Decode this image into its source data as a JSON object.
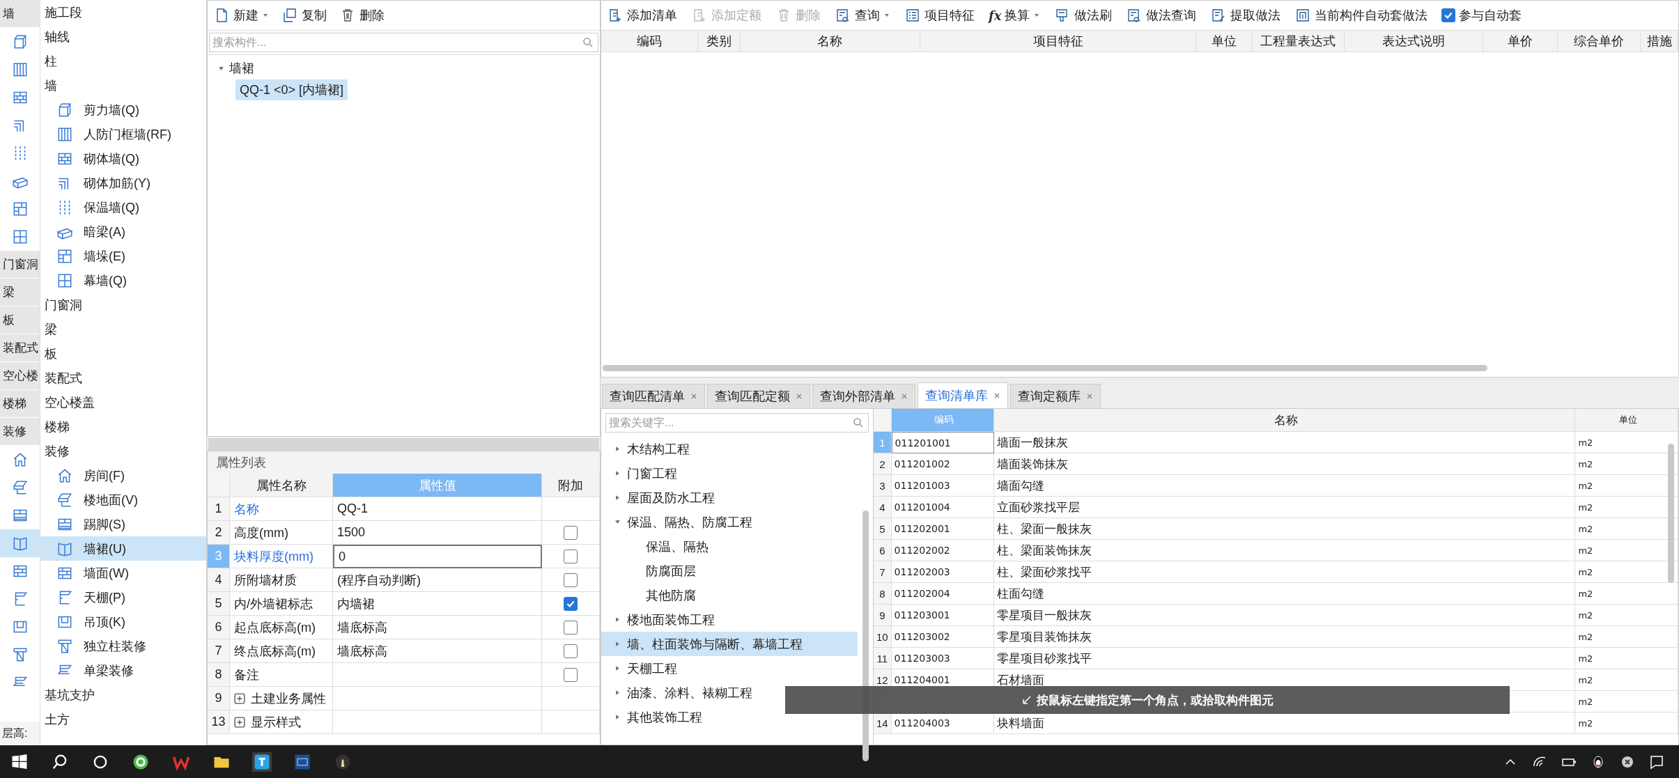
{
  "icon_strip": [
    {
      "kind": "header",
      "label": "墙"
    },
    {
      "kind": "icon",
      "selected": false
    },
    {
      "kind": "icon",
      "selected": false
    },
    {
      "kind": "icon",
      "selected": false
    },
    {
      "kind": "icon",
      "selected": false
    },
    {
      "kind": "icon",
      "selected": false
    },
    {
      "kind": "icon",
      "selected": false
    },
    {
      "kind": "icon",
      "selected": false
    },
    {
      "kind": "icon",
      "selected": false
    },
    {
      "kind": "header",
      "label": "门窗洞"
    },
    {
      "kind": "header",
      "label": "梁"
    },
    {
      "kind": "header",
      "label": "板"
    },
    {
      "kind": "header",
      "label": "装配式"
    },
    {
      "kind": "header",
      "label": "空心楼"
    },
    {
      "kind": "header",
      "label": "楼梯"
    },
    {
      "kind": "header",
      "label": "装修"
    },
    {
      "kind": "icon",
      "selected": false
    },
    {
      "kind": "icon",
      "selected": false
    },
    {
      "kind": "icon",
      "selected": false
    },
    {
      "kind": "icon",
      "selected": true
    },
    {
      "kind": "icon",
      "selected": false
    },
    {
      "kind": "icon",
      "selected": false
    },
    {
      "kind": "icon",
      "selected": false
    },
    {
      "kind": "icon",
      "selected": false
    },
    {
      "kind": "icon",
      "selected": false
    }
  ],
  "floor_height_label": "层高:",
  "component_types": [
    {
      "label": "施工段",
      "selected": false
    },
    {
      "label": "轴线",
      "selected": false
    },
    {
      "label": "柱",
      "selected": false
    },
    {
      "label": "墙",
      "selected": false,
      "children": [
        {
          "label": "剪力墙(Q)",
          "selected": false
        },
        {
          "label": "人防门框墙(RF)",
          "selected": false
        },
        {
          "label": "砌体墙(Q)",
          "selected": false
        },
        {
          "label": "砌体加筋(Y)",
          "selected": false
        },
        {
          "label": "保温墙(Q)",
          "selected": false
        },
        {
          "label": "暗梁(A)",
          "selected": false
        },
        {
          "label": "墙垛(E)",
          "selected": false
        },
        {
          "label": "幕墙(Q)",
          "selected": false
        }
      ]
    },
    {
      "label": "门窗洞",
      "selected": false
    },
    {
      "label": "梁",
      "selected": false
    },
    {
      "label": "板",
      "selected": false
    },
    {
      "label": "装配式",
      "selected": false
    },
    {
      "label": "空心楼盖",
      "selected": false
    },
    {
      "label": "楼梯",
      "selected": false
    },
    {
      "label": "装修",
      "selected": false,
      "children": [
        {
          "label": "房间(F)",
          "selected": false
        },
        {
          "label": "楼地面(V)",
          "selected": false
        },
        {
          "label": "踢脚(S)",
          "selected": false
        },
        {
          "label": "墙裙(U)",
          "selected": true
        },
        {
          "label": "墙面(W)",
          "selected": false
        },
        {
          "label": "天棚(P)",
          "selected": false
        },
        {
          "label": "吊顶(K)",
          "selected": false
        },
        {
          "label": "独立柱装修",
          "selected": false
        },
        {
          "label": "单梁装修",
          "selected": false
        }
      ]
    },
    {
      "label": "基坑支护",
      "selected": false
    },
    {
      "label": "土方",
      "selected": false
    }
  ],
  "component_toolbar": [
    {
      "label": "新建",
      "dropdown": true
    },
    {
      "label": "复制",
      "dropdown": false
    },
    {
      "label": "删除",
      "dropdown": false
    }
  ],
  "component_search": {
    "placeholder": "搜索构件..."
  },
  "component_list": [
    {
      "label": "墙裙",
      "expanded": true,
      "children": [
        {
          "label": "QQ-1 <0> [内墙裙]",
          "selected": true
        }
      ]
    }
  ],
  "properties": {
    "title": "属性列表",
    "columns": [
      "属性名称",
      "属性值",
      "附加"
    ],
    "rows": [
      {
        "no": "1",
        "name": "名称",
        "value": "QQ-1",
        "kind": "fixed",
        "emphasized": true,
        "selected": false
      },
      {
        "no": "2",
        "name": "高度(mm)",
        "value": "1500",
        "kind": "check",
        "attached": false,
        "emphasized": false,
        "selected": false
      },
      {
        "no": "3",
        "name": "块料厚度(mm)",
        "value": "0",
        "kind": "check",
        "attached": false,
        "emphasized": true,
        "selected": true
      },
      {
        "no": "4",
        "name": "所附墙材质",
        "value": "(程序自动判断)",
        "kind": "check",
        "attached": false,
        "emphasized": false,
        "selected": false
      },
      {
        "no": "5",
        "name": "内/外墙裙标志",
        "value": "内墙裙",
        "kind": "check",
        "attached": true,
        "emphasized": false,
        "selected": false
      },
      {
        "no": "6",
        "name": "起点底标高(m)",
        "value": "墙底标高",
        "kind": "check",
        "attached": false,
        "emphasized": false,
        "selected": false
      },
      {
        "no": "7",
        "name": "终点底标高(m)",
        "value": "墙底标高",
        "kind": "check",
        "attached": false,
        "emphasized": false,
        "selected": false
      },
      {
        "no": "8",
        "name": "备注",
        "kind": "check",
        "attached": false,
        "emphasized": false,
        "selected": false
      },
      {
        "no": "9",
        "name": "土建业务属性",
        "kind": "group",
        "expanded": false,
        "emphasized": false,
        "selected": false
      },
      {
        "no": "13",
        "name": "显示样式",
        "kind": "group",
        "expanded": false,
        "emphasized": false,
        "selected": false
      }
    ]
  },
  "method_toolbar": [
    {
      "label": "添加清单",
      "disabled": false,
      "dropdown": false
    },
    {
      "label": "添加定额",
      "disabled": true,
      "dropdown": false
    },
    {
      "label": "删除",
      "disabled": true,
      "dropdown": false
    },
    {
      "label": "查询",
      "disabled": false,
      "dropdown": true
    },
    {
      "label": "项目特征",
      "disabled": false,
      "dropdown": false
    },
    {
      "label": "换算",
      "glyph": "fx",
      "disabled": false,
      "dropdown": true
    },
    {
      "label": "做法刷",
      "disabled": false,
      "dropdown": false
    },
    {
      "label": "做法查询",
      "disabled": false,
      "dropdown": false
    },
    {
      "label": "提取做法",
      "disabled": false,
      "dropdown": false
    },
    {
      "label": "当前构件自动套做法",
      "disabled": false,
      "dropdown": false
    }
  ],
  "auto_apply": {
    "label": "参与自动套",
    "checked": true
  },
  "method_table": {
    "columns": [
      "编码",
      "类别",
      "名称",
      "项目特征",
      "单位",
      "工程量表达式",
      "表达式说明",
      "单价",
      "综合单价",
      "措施"
    ]
  },
  "query_tabs": [
    {
      "label": "查询匹配清单",
      "selected": false
    },
    {
      "label": "查询匹配定额",
      "selected": false
    },
    {
      "label": "查询外部清单",
      "selected": false
    },
    {
      "label": "查询清单库",
      "selected": true
    },
    {
      "label": "查询定额库",
      "selected": false
    }
  ],
  "library_search": {
    "placeholder": "搜索关键字..."
  },
  "library_tree": [
    {
      "label": "木结构工程",
      "expanded": false,
      "selected": false
    },
    {
      "label": "门窗工程",
      "expanded": false,
      "selected": false
    },
    {
      "label": "屋面及防水工程",
      "expanded": false,
      "selected": false
    },
    {
      "label": "保温、隔热、防腐工程",
      "expanded": true,
      "selected": false,
      "children": [
        {
          "label": "保温、隔热",
          "selected": false
        },
        {
          "label": "防腐面层",
          "selected": false
        },
        {
          "label": "其他防腐",
          "selected": false
        }
      ]
    },
    {
      "label": "楼地面装饰工程",
      "expanded": false,
      "selected": false
    },
    {
      "label": "墙、柱面装饰与隔断、幕墙工程",
      "expanded": false,
      "selected": true
    },
    {
      "label": "天棚工程",
      "expanded": false,
      "selected": false
    },
    {
      "label": "油漆、涂料、裱糊工程",
      "expanded": false,
      "selected": false
    },
    {
      "label": "其他装饰工程",
      "expanded": false,
      "selected": false
    }
  ],
  "library_table": {
    "columns": [
      "编码",
      "名称",
      "单位"
    ],
    "rows": [
      {
        "no": "1",
        "code": "011201001",
        "name": "墙面一般抹灰",
        "unit": "m2",
        "selected": true
      },
      {
        "no": "2",
        "code": "011201002",
        "name": "墙面装饰抹灰",
        "unit": "m2",
        "selected": false
      },
      {
        "no": "3",
        "code": "011201003",
        "name": "墙面勾缝",
        "unit": "m2",
        "selected": false
      },
      {
        "no": "4",
        "code": "011201004",
        "name": "立面砂浆找平层",
        "unit": "m2",
        "selected": false
      },
      {
        "no": "5",
        "code": "011202001",
        "name": "柱、梁面一般抹灰",
        "unit": "m2",
        "selected": false
      },
      {
        "no": "6",
        "code": "011202002",
        "name": "柱、梁面装饰抹灰",
        "unit": "m2",
        "selected": false
      },
      {
        "no": "7",
        "code": "011202003",
        "name": "柱、梁面砂浆找平",
        "unit": "m2",
        "selected": false
      },
      {
        "no": "8",
        "code": "011202004",
        "name": "柱面勾缝",
        "unit": "m2",
        "selected": false
      },
      {
        "no": "9",
        "code": "011203001",
        "name": "零星项目一般抹灰",
        "unit": "m2",
        "selected": false
      },
      {
        "no": "10",
        "code": "011203002",
        "name": "零星项目装饰抹灰",
        "unit": "m2",
        "selected": false
      },
      {
        "no": "11",
        "code": "011203003",
        "name": "零星项目砂浆找平",
        "unit": "m2",
        "selected": false
      },
      {
        "no": "12",
        "code": "011204001",
        "name": "石材墙面",
        "unit": "m2",
        "selected": false
      },
      {
        "unit": "m2",
        "selected": false
      },
      {
        "no": "14",
        "code": "011204003",
        "name": "块料墙面",
        "unit": "m2",
        "selected": false
      }
    ]
  },
  "status_tip": "按鼠标左键指定第一个角点，或拾取构件图元"
}
